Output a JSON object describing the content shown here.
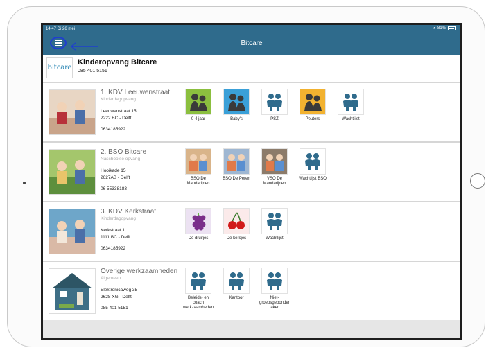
{
  "status": {
    "time": "14:47  Di 26 mei",
    "battery": "81%"
  },
  "nav": {
    "title": "Bitcare"
  },
  "org": {
    "logo_text": "bitcare",
    "name": "Kinderopvang Bitcare",
    "phone": "085 401 5151"
  },
  "locations": [
    {
      "title": "1. KDV Leeuwenstraat",
      "type": "Kinderdagopvang",
      "street": "Leeuwenstraat 15",
      "city": "2222 BC - Delft",
      "phone": "0634185922",
      "groups": [
        {
          "label": "0-4 jaar",
          "icon": "kids-dark-icon",
          "bg": "#8bbf3f"
        },
        {
          "label": "Baby's",
          "icon": "baby-dark-icon",
          "bg": "#3aa0d8"
        },
        {
          "label": "PSZ",
          "icon": "people-icon",
          "bg": "#ffffff"
        },
        {
          "label": "Peuters",
          "icon": "toddler-dark-icon",
          "bg": "#f2b230"
        },
        {
          "label": "Wachtlijst",
          "icon": "people-icon",
          "bg": "#ffffff"
        }
      ]
    },
    {
      "title": "2. BSO Bitcare",
      "type": "Naschoolse opvang",
      "street": "Hooikade 15",
      "city": "2627AB - Delft",
      "phone": "06 55338183",
      "groups": [
        {
          "label": "BSO De Mandarijnen",
          "icon": "children-photo-icon",
          "bg": "#d9b48a"
        },
        {
          "label": "BSO De Peren",
          "icon": "children-photo-icon",
          "bg": "#9fb7d2"
        },
        {
          "label": "VSO De Mandarijnen",
          "icon": "children-photo-icon",
          "bg": "#8c7b6a"
        },
        {
          "label": "Wachtlijst BSO",
          "icon": "people-icon",
          "bg": "#ffffff"
        }
      ]
    },
    {
      "title": "3. KDV Kerkstraat",
      "type": "Kinderdagopvang",
      "street": "Kerkstraat 1",
      "city": "1111 BC - Delft",
      "phone": "0634185922",
      "groups": [
        {
          "label": "De druifjes",
          "icon": "grapes-icon",
          "bg": "#ece2f2"
        },
        {
          "label": "De kersjes",
          "icon": "cherries-icon",
          "bg": "#fbeaea"
        },
        {
          "label": "Wachtlijst",
          "icon": "people-icon",
          "bg": "#ffffff"
        }
      ]
    },
    {
      "title": "Overige werkzaamheden",
      "type": "Algemeen",
      "street": "Elektronicaweg 35",
      "city": "2628 XG - Delft",
      "phone": "085 401 5151",
      "groups": [
        {
          "label": "Beleids- en coach werkzaamheden",
          "icon": "people-icon",
          "bg": "#ffffff"
        },
        {
          "label": "Kantoor",
          "icon": "people-icon",
          "bg": "#ffffff"
        },
        {
          "label": "Niet-groepsgebonden taken",
          "icon": "people-icon",
          "bg": "#ffffff"
        }
      ]
    }
  ],
  "colors": {
    "navbar": "#2f6b8c",
    "accent": "#1f3fcf",
    "people_icon": "#2f6b8c"
  }
}
